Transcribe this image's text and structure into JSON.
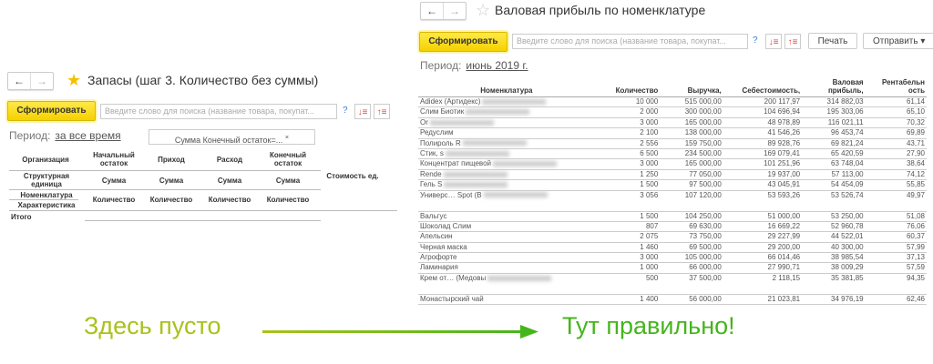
{
  "left": {
    "title": "Запасы (шаг 3. Количество без суммы)",
    "generate": "Сформировать",
    "search_placeholder": "Введите слово для поиска (название товара, покупат...",
    "help": "?",
    "period_label": "Период:",
    "period_value": "за все время",
    "filter": "Сумма Конечный остаток=...",
    "filter_close": "×",
    "headers": {
      "org": "Организация",
      "start": "Начальный остаток",
      "in": "Приход",
      "out": "Расход",
      "end": "Конечный остаток",
      "struct": "Структурная единица",
      "sum": "Сумма",
      "nom": "Номенклатура",
      "char": "Характеристика",
      "qty": "Количество",
      "cost": "Стоимость ед.",
      "total": "Итого"
    }
  },
  "right": {
    "title": "Валовая прибыль по номенклатуре",
    "generate": "Сформировать",
    "search_placeholder": "Введите слово для поиска (название товара, покупат...",
    "help": "?",
    "print": "Печать",
    "send": "Отправить",
    "period_label": "Период:",
    "period_value": "июнь 2019 г.",
    "columns": [
      "Номенклатура",
      "Количество",
      "Выручка,",
      "Себестоимость,",
      "Валовая прибыль,",
      "Рентабельн ость"
    ],
    "rows": [
      [
        "Adidex (Артидекс)",
        "10 000",
        "515 000,00",
        "200 117,97",
        "314 882,03",
        "61,14"
      ],
      [
        "Слим Биотик",
        "2 000",
        "300 000,00",
        "104 696,94",
        "195 303,06",
        "65,10"
      ],
      [
        "Or",
        "3 000",
        "165 000,00",
        "48 978,89",
        "116 021,11",
        "70,32"
      ],
      [
        "Редуслим",
        "2 100",
        "138 000,00",
        "41 546,26",
        "96 453,74",
        "69,89"
      ],
      [
        "Полироль R",
        "2 556",
        "159 750,00",
        "89 928,76",
        "69 821,24",
        "43,71"
      ],
      [
        "Стик, s",
        "6 500",
        "234 500,00",
        "169 079,41",
        "65 420,59",
        "27,90"
      ],
      [
        "Концентрат пищевой",
        "3 000",
        "165 000,00",
        "101 251,96",
        "63 748,04",
        "38,64"
      ],
      [
        "Rende",
        "1 250",
        "77 050,00",
        "19 937,00",
        "57 113,00",
        "74,12"
      ],
      [
        "Гель S",
        "1 500",
        "97 500,00",
        "43 045,91",
        "54 454,09",
        "55,85"
      ],
      [
        "Универс… Spot (B",
        "3 056",
        "107 120,00",
        "53 593,26",
        "53 526,74",
        "49,97"
      ],
      [
        "Вальгус",
        "1 500",
        "104 250,00",
        "51 000,00",
        "53 250,00",
        "51,08"
      ],
      [
        "Шоколад Слим",
        "807",
        "69 630,00",
        "16 669,22",
        "52 960,78",
        "76,06"
      ],
      [
        "Апельсин",
        "2 075",
        "73 750,00",
        "29 227,99",
        "44 522,01",
        "60,37"
      ],
      [
        "Черная маска",
        "1 460",
        "69 500,00",
        "29 200,00",
        "40 300,00",
        "57,99"
      ],
      [
        "Агрофорте",
        "3 000",
        "105 000,00",
        "66 014,46",
        "38 985,54",
        "37,13"
      ],
      [
        "Ламинария",
        "1 000",
        "66 000,00",
        "27 990,71",
        "38 009,29",
        "57,59"
      ],
      [
        "Крем от… (Медовы",
        "500",
        "37 500,00",
        "2 118,15",
        "35 381,85",
        "94,35"
      ],
      [
        "Монастырский чай",
        "1 400",
        "56 000,00",
        "21 023,81",
        "34 976,19",
        "62,46"
      ]
    ]
  },
  "captions": {
    "empty": "Здесь пусто",
    "correct": "Тут правильно!"
  },
  "colors": {
    "empty": "#a9c21a",
    "correct": "#45b51c",
    "accent": "#f5d100"
  }
}
